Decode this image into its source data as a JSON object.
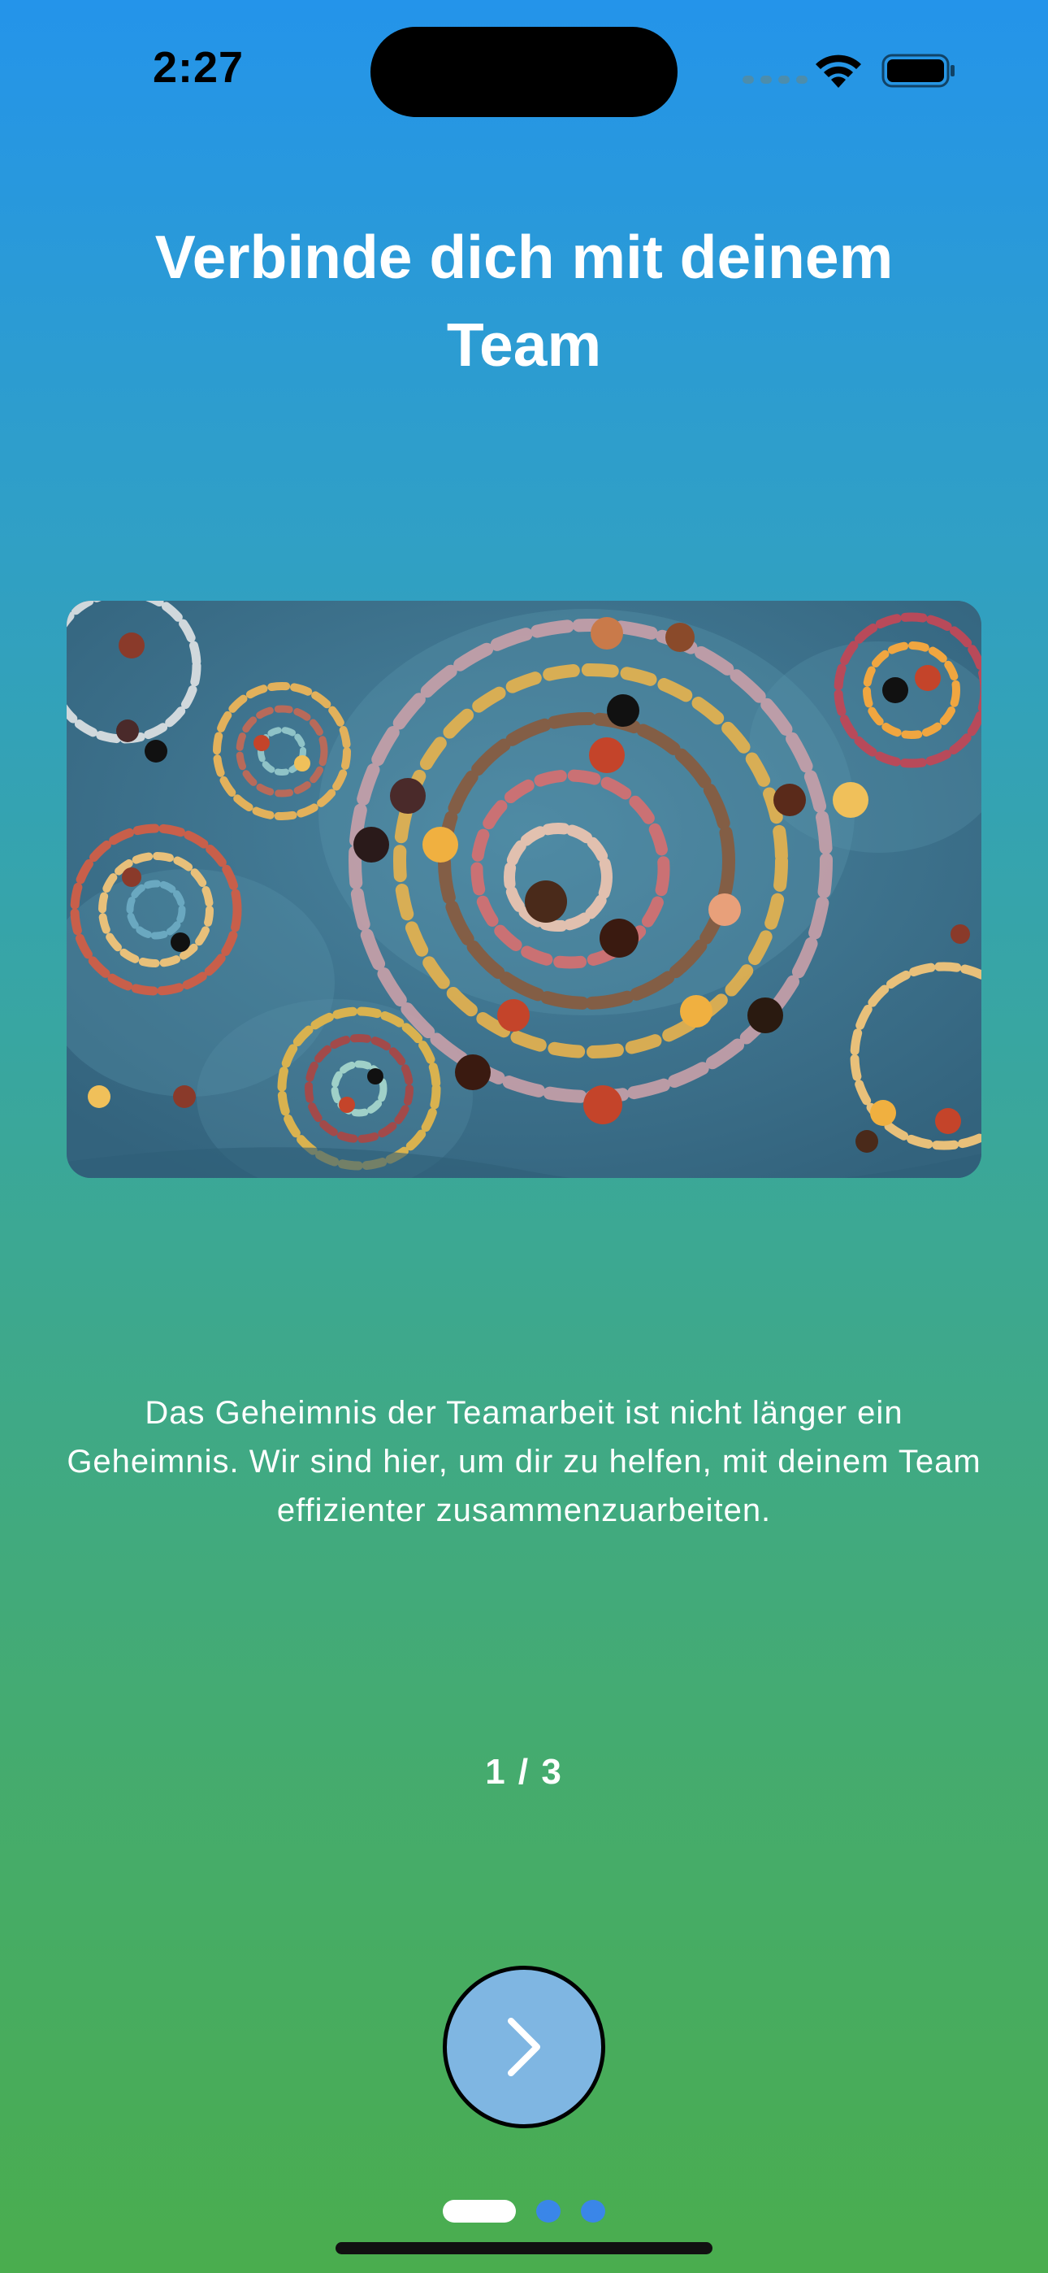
{
  "status_bar": {
    "time": "2:27"
  },
  "onboarding": {
    "title": "Verbinde dich mit deinem Team",
    "description": "Das Geheimnis der Teamarbeit ist nicht länger ein Geheimnis. Wir sind hier, um dir zu helfen, mit deinem Team effizienter zusammenzuarbeiten.",
    "page_counter": "1 / 3",
    "current_page": 1,
    "total_pages": 3
  },
  "icons": {
    "next_button": "chevron-right-icon",
    "wifi": "wifi-icon",
    "battery": "battery-icon"
  },
  "colors": {
    "gradient_top": "#2494ea",
    "gradient_bottom": "#4aad4e",
    "button_fill": "#7fb6e2",
    "active_dot": "#ffffff",
    "inactive_dot": "#3a86e8"
  }
}
